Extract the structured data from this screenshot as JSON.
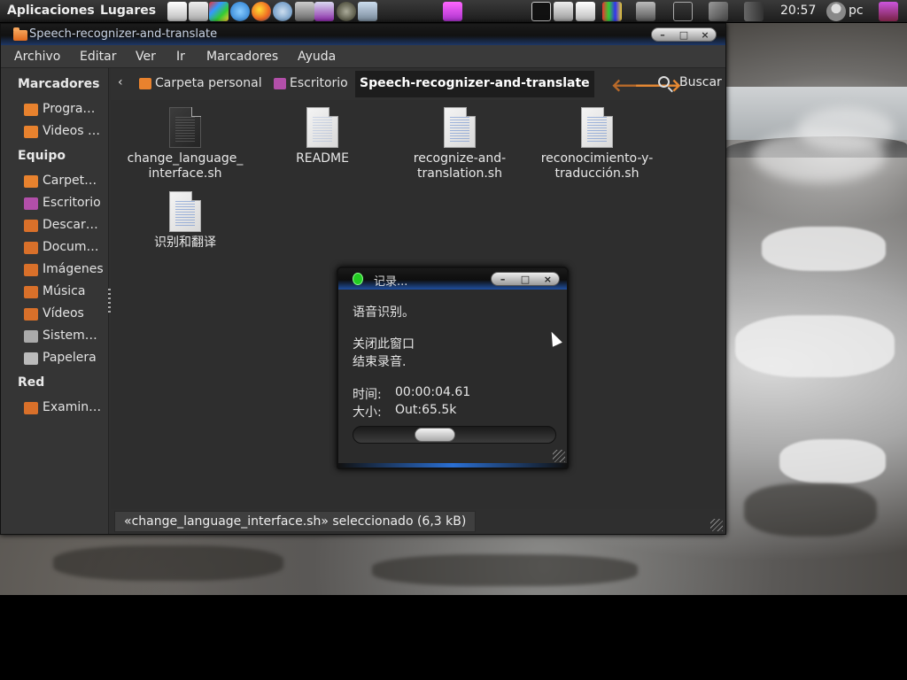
{
  "top_panel": {
    "menus": [
      "Aplicaciones",
      "Lugares"
    ],
    "clock": "20:57",
    "user": "pc",
    "launcher_icons": [
      "text-editor-icon",
      "text-editor-icon",
      "office-icon",
      "dictionary-icon",
      "firefox-icon",
      "chromium-icon",
      "terminal-icon",
      "screenshot-icon",
      "steam-icon",
      "network-icon"
    ],
    "tray_icons": [
      "app-icon",
      "terminal-icon",
      "mail-icon",
      "notes-icon",
      "monitor-icon",
      "monitor-icon",
      "envelope-icon",
      "network-icon",
      "volume-icon",
      "user-icon",
      "display-icon"
    ]
  },
  "window": {
    "title": "Speech-recognizer-and-translate",
    "buttons": [
      "–",
      "□",
      "×"
    ]
  },
  "menubar": {
    "items": [
      "Archivo",
      "Editar",
      "Ver",
      "Ir",
      "Marcadores",
      "Ayuda"
    ]
  },
  "sidebar": {
    "sections": [
      {
        "heading": "Marcadores",
        "items": [
          {
            "label": "Progra…",
            "icon": "folder-icon",
            "color": "#e8822e"
          },
          {
            "label": "Videos …",
            "icon": "folder-icon",
            "color": "#e8822e"
          }
        ]
      },
      {
        "heading": "Equipo",
        "items": [
          {
            "label": "Carpet…",
            "icon": "home-folder-icon",
            "color": "#e8822e"
          },
          {
            "label": "Escritorio",
            "icon": "desktop-icon",
            "color": "#b24fa9"
          },
          {
            "label": "Descar…",
            "icon": "downloads-icon",
            "color": "#d9702a"
          },
          {
            "label": "Docum…",
            "icon": "documents-icon",
            "color": "#d9702a"
          },
          {
            "label": "Imágenes",
            "icon": "pictures-icon",
            "color": "#d9702a"
          },
          {
            "label": "Música",
            "icon": "music-icon",
            "color": "#d9702a"
          },
          {
            "label": "Vídeos",
            "icon": "videos-icon",
            "color": "#d9702a"
          },
          {
            "label": "Sistem…",
            "icon": "drive-icon",
            "color": "#aaaaaa"
          },
          {
            "label": "Papelera",
            "icon": "trash-icon",
            "color": "#bbbbbb"
          }
        ]
      },
      {
        "heading": "Red",
        "items": [
          {
            "label": "Examin…",
            "icon": "network-folder-icon",
            "color": "#d9702a"
          }
        ]
      }
    ]
  },
  "pathbar": {
    "back": "‹",
    "crumbs": [
      {
        "label": "Carpeta personal",
        "icon": "home-icon",
        "color": "#e8822e"
      },
      {
        "label": "Escritorio",
        "icon": "desktop-icon",
        "color": "#b24fa9"
      },
      {
        "label": "Speech-recognizer-and-translate",
        "icon": "",
        "color": ""
      }
    ],
    "nav_back": "🡐",
    "nav_forward": "🡒",
    "search": "Buscar"
  },
  "files": [
    {
      "name": "change_language_\ninterface.sh",
      "style": "dark"
    },
    {
      "name": "README",
      "style": "light"
    },
    {
      "name": "recognize-and-\ntranslation.sh",
      "style": "light"
    },
    {
      "name": "reconocimiento-y-\ntraducción.sh",
      "style": "light"
    },
    {
      "name": "识别和翻译",
      "style": "light"
    }
  ],
  "statusbar": {
    "text": "«change_language_interface.sh» seleccionado (6,3 kB)"
  },
  "recorder": {
    "title": "记录...",
    "line1": "语音识别。",
    "line2": "关闭此窗口",
    "line3": "结束录音.",
    "time_label": "时间:",
    "time_value": "00:00:04.61",
    "size_label": "大小:",
    "size_value": "Out:65.5k",
    "progress": 0.38,
    "buttons": [
      "–",
      "□",
      "×"
    ]
  }
}
